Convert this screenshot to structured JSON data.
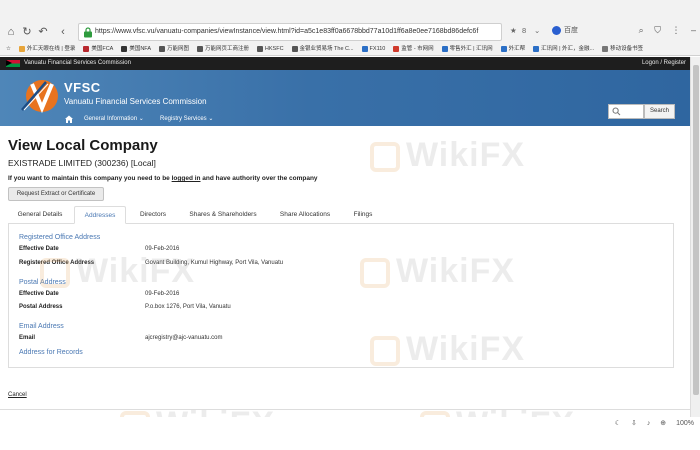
{
  "browser": {
    "url": "https://www.vfsc.vu/vanuatu-companies/viewInstance/view.html?id=a5c1e83ff0a6678bbd77a10d1ff6a8e0ee7168bd86defc6f",
    "star": "★",
    "toolbar_num": "8",
    "search_engine": "百度",
    "bookmarks": [
      "外汇天眼在线 | 登录",
      "美国FCA",
      "美国NFA",
      "万能网图",
      "万能网页工商注册",
      "HKSFC",
      "金银业贸易场 The C...",
      "FX110",
      "监管 - 市网网",
      "零售外汇 | 汇讯网",
      "外汇帮",
      "汇讯网 | 外汇，金融...",
      "移动设备书签"
    ]
  },
  "site": {
    "org_name": "Vanuatu Financial Services Commission",
    "logon": "Logon / Register",
    "logo_text": "VFSC",
    "logo_sub": "Vanuatu Financial Services Commission",
    "menu": [
      "General Information ⌄",
      "Registry Services ⌄"
    ],
    "search_placeholder": "",
    "search_button": "Search"
  },
  "page": {
    "title": "View Local Company",
    "company": "EXISTRADE LIMITED (300236) [Local]",
    "note_before": "If you want to maintain this company you need to be ",
    "note_link": "logged in",
    "note_after": " and have authority over the company",
    "request_button": "Request Extract or Certificate",
    "tabs": [
      "General Details",
      "Addresses",
      "Directors",
      "Shares & Shareholders",
      "Share Allocations",
      "Filings"
    ],
    "active_tab": "Addresses",
    "sections": {
      "registered_office": {
        "heading": "Registered Office Address",
        "effective_label": "Effective Date",
        "effective_value": "09-Feb-2016",
        "address_label": "Registered Office Address",
        "address_value": "Govant Building, Kumul Highway, Port Vila, Vanuatu"
      },
      "postal": {
        "heading": "Postal Address",
        "effective_label": "Effective Date",
        "effective_value": "09-Feb-2016",
        "address_label": "Postal Address",
        "address_value": "P.o.box 1276, Port Vila, Vanuatu"
      },
      "email": {
        "heading": "Email Address",
        "label": "Email",
        "value": "ajcregistry@ajc-vanuatu.com"
      },
      "records": {
        "heading": "Address for Records"
      }
    },
    "cancel": "Cancel"
  },
  "status_bar": {
    "zoom": "100%"
  },
  "watermark": "WikiFX",
  "colors": {
    "banner": "#3970a8",
    "link_blue": "#4a78b3",
    "topbar": "#1e1e1e"
  }
}
